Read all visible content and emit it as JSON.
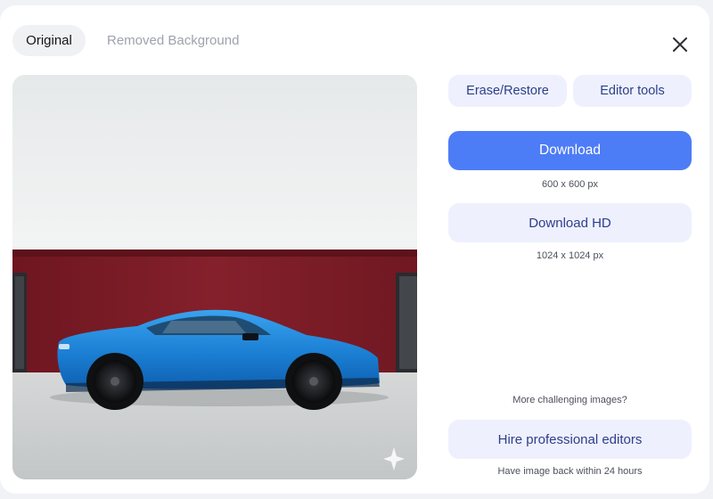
{
  "tabs": {
    "original": "Original",
    "removed": "Removed Background"
  },
  "editor": {
    "erase_restore": "Erase/Restore",
    "editor_tools": "Editor tools"
  },
  "download": {
    "label": "Download",
    "size": "600 x 600 px"
  },
  "download_hd": {
    "label": "Download HD",
    "size": "1024 x 1024 px"
  },
  "pro": {
    "prompt": "More challenging images?",
    "button": "Hire professional editors",
    "note": "Have image back within 24 hours"
  },
  "colors": {
    "accent": "#4d7cf7",
    "soft_button": "#eef1fd",
    "car_body": "#2387d8",
    "wall": "#7b1c26"
  },
  "icons": {
    "close": "close-icon",
    "sparkle": "sparkle-icon"
  }
}
